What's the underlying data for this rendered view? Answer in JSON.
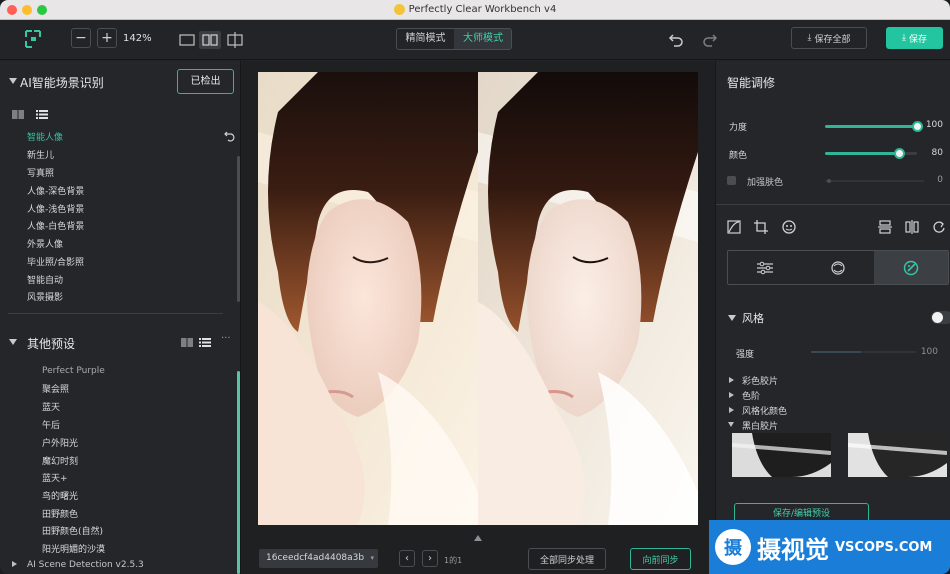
{
  "window": {
    "title": "Perfectly Clear Workbench v4"
  },
  "toolbar": {
    "zoom": "142%",
    "mode_simple": "精简模式",
    "mode_master": "大师模式",
    "save_all": "保存全部",
    "save": "保存"
  },
  "left": {
    "scene_title": "AI智能场景识别",
    "detected_button": "已检出",
    "scene_items": [
      "智能人像",
      "新生儿",
      "写真照",
      "人像-深色背景",
      "人像-浅色背景",
      "人像-白色背景",
      "外景人像",
      "毕业照/合影照",
      "智能自动",
      "风景摄影"
    ],
    "preset_title": "其他预设",
    "preset_items": [
      "Perfect Purple",
      "聚会照",
      "蓝天",
      "午后",
      "户外阳光",
      "魔幻时刻",
      "蓝天+",
      "鸟的曙光",
      "田野颜色",
      "田野颜色(自然)",
      "阳光明媚的沙漠"
    ],
    "footer_item": "AI Scene Detection v2.5.3"
  },
  "bottom": {
    "filename": "16ceedcf4ad4408a3b",
    "page": "1的1",
    "sync_all": "全部同步处理",
    "sync_forward": "向前同步"
  },
  "right": {
    "title": "智能调修",
    "sliders": [
      {
        "label": "力度",
        "value": 100,
        "fraction": 1.0
      },
      {
        "label": "颜色",
        "value": 80,
        "fraction": 0.8
      },
      {
        "label": "加强肤色",
        "value": 0,
        "fraction": 0.0
      }
    ],
    "style_section": "风格",
    "intensity_label": "强度",
    "intensity_value": 100,
    "sub_items": [
      "彩色胶片",
      "色阶",
      "风格化颜色",
      "黑白胶片"
    ],
    "preset_button": "保存/编辑预设"
  },
  "watermark": {
    "brand": "摄视觉",
    "site": "VSCOPS.COM"
  },
  "colors": {
    "accent": "#2fb597",
    "background": "#202224",
    "panel": "#24262a"
  }
}
